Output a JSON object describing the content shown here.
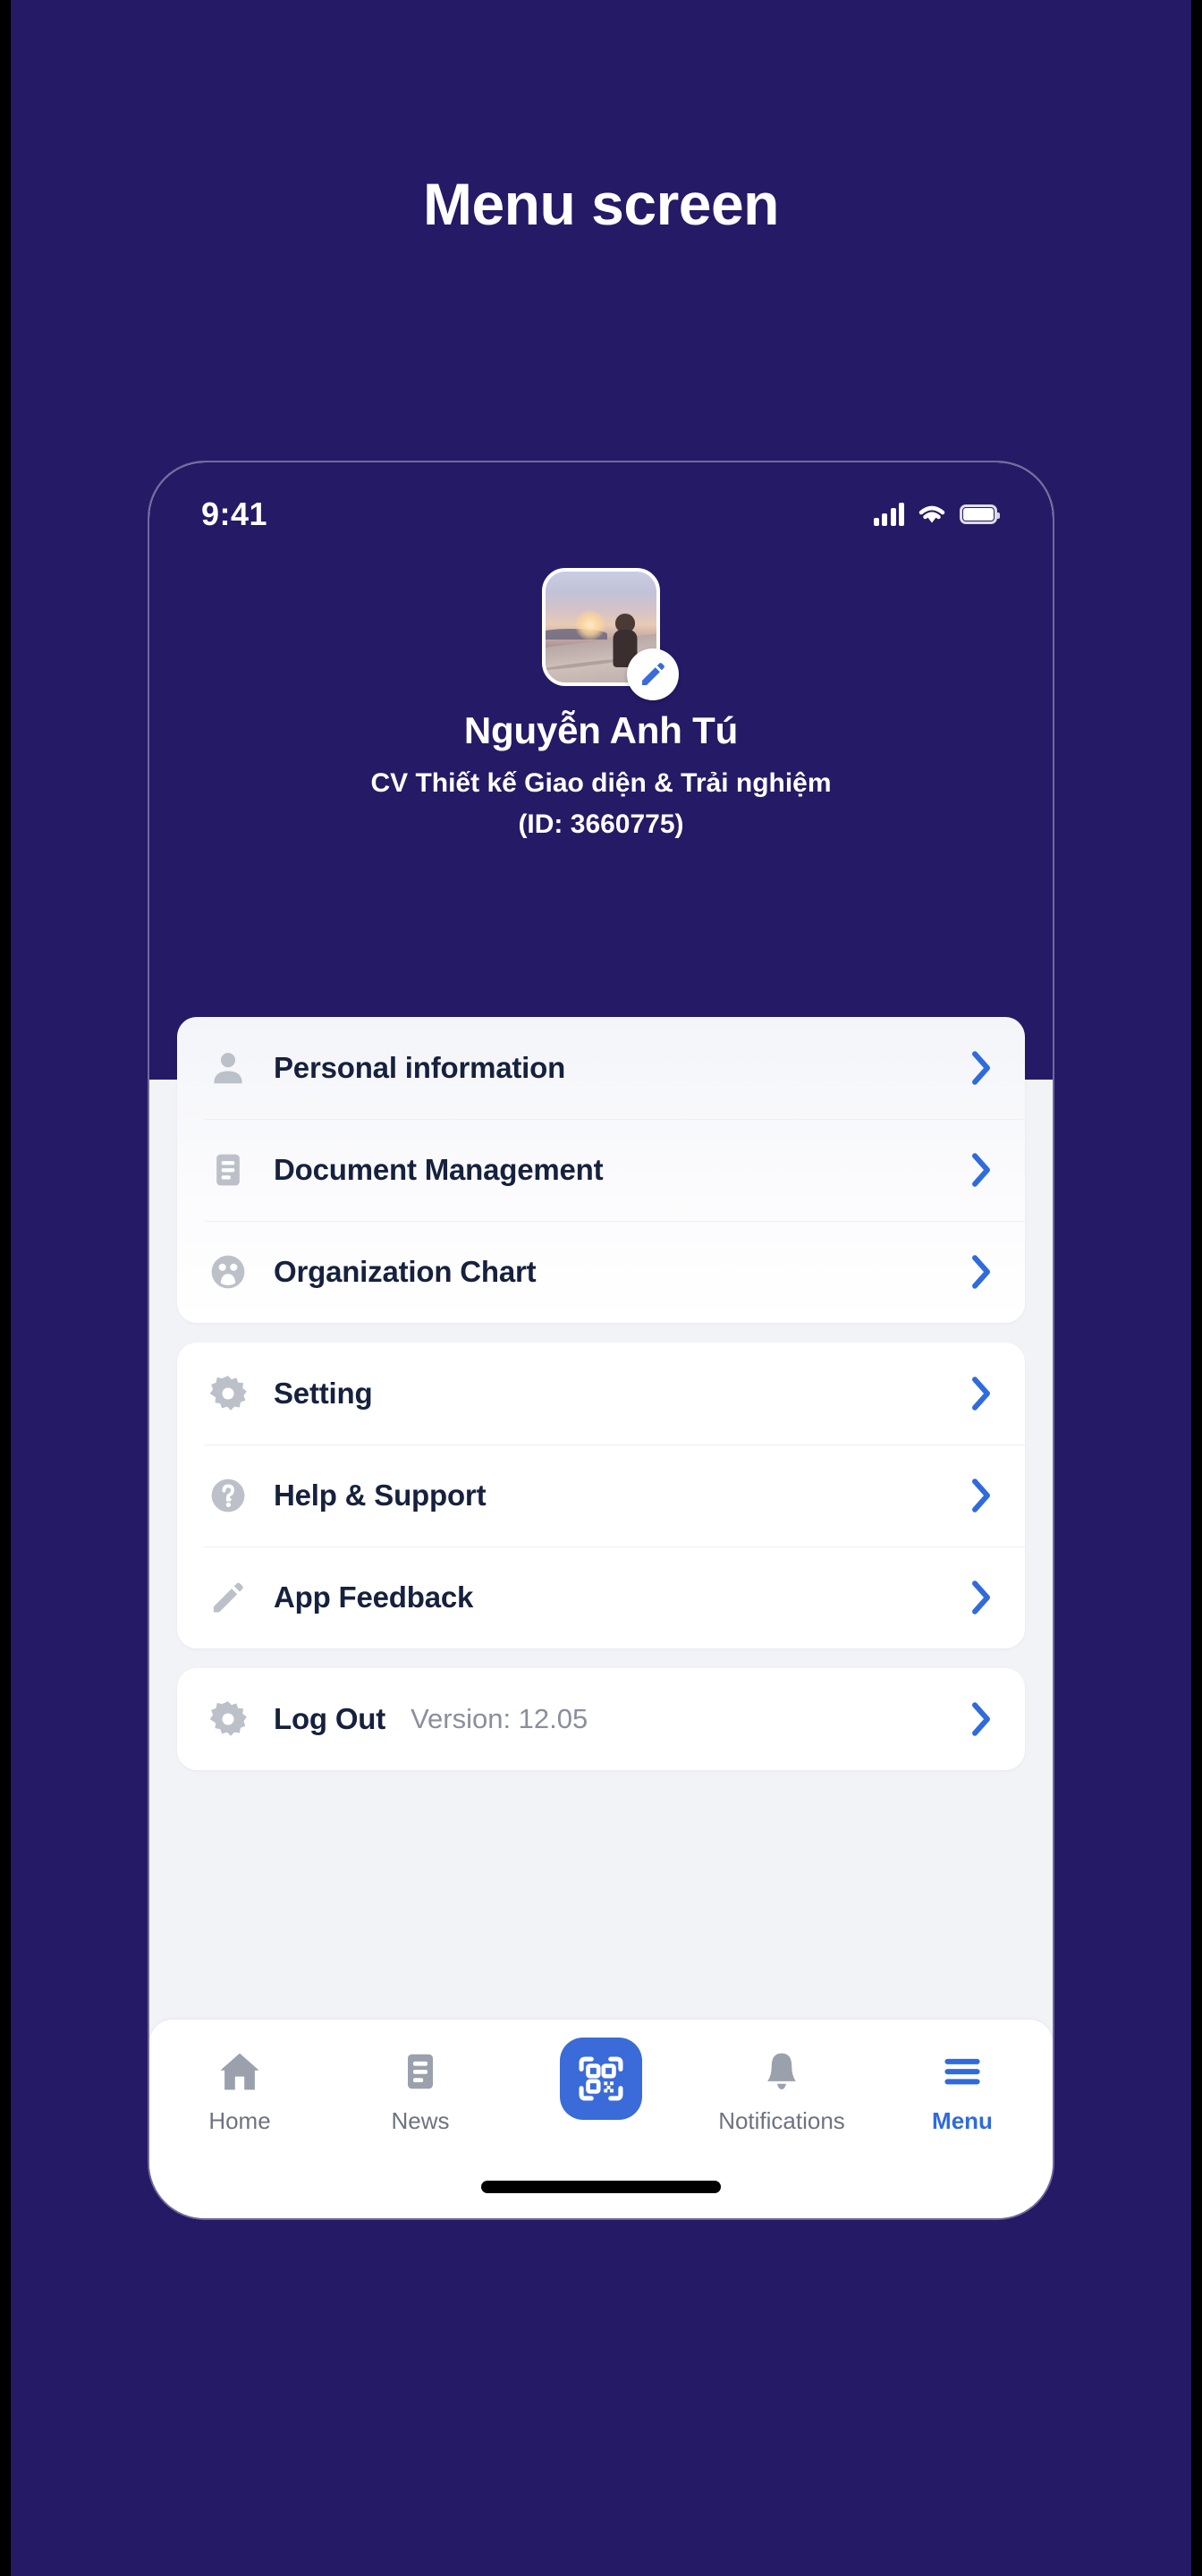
{
  "page": {
    "title": "Menu screen",
    "background_color": "#251A66",
    "accent_color": "#2F6BDC"
  },
  "status_bar": {
    "time": "9:41",
    "icons": [
      "signal-bars-icon",
      "wifi-icon",
      "battery-icon"
    ]
  },
  "profile": {
    "avatar_alt": "profile-photo-sunset-beach",
    "edit_badge_icon": "pencil-icon",
    "name": "Nguyễn Anh Tú",
    "role": "CV Thiết kế Giao diện & Trải nghiệm",
    "id_line": "(ID: 3660775)"
  },
  "menu_groups": [
    {
      "items": [
        {
          "label": "Personal information",
          "icon": "person-icon",
          "chevron": "chevron-right-icon"
        },
        {
          "label": "Document Management",
          "icon": "document-icon",
          "chevron": "chevron-right-icon"
        },
        {
          "label": "Organization Chart",
          "icon": "organization-icon",
          "chevron": "chevron-right-icon"
        }
      ]
    },
    {
      "items": [
        {
          "label": "Setting",
          "icon": "gear-icon",
          "chevron": "chevron-right-icon"
        },
        {
          "label": "Help & Support",
          "icon": "help-circle-icon",
          "chevron": "chevron-right-icon"
        },
        {
          "label": "App Feedback",
          "icon": "pencil-icon",
          "chevron": "chevron-right-icon"
        }
      ]
    },
    {
      "items": [
        {
          "label": "Log Out",
          "icon": "gear-icon",
          "meta": "Version: 12.05",
          "chevron": "chevron-right-icon"
        }
      ]
    }
  ],
  "tabbar": {
    "tabs": [
      {
        "label": "Home",
        "icon": "home-icon",
        "active": false
      },
      {
        "label": "News",
        "icon": "news-icon",
        "active": false
      },
      {
        "label": "",
        "icon": "qr-scan-icon",
        "active": false
      },
      {
        "label": "Notifications",
        "icon": "bell-icon",
        "active": false
      },
      {
        "label": "Menu",
        "icon": "hamburger-menu-icon",
        "active": true
      }
    ]
  }
}
